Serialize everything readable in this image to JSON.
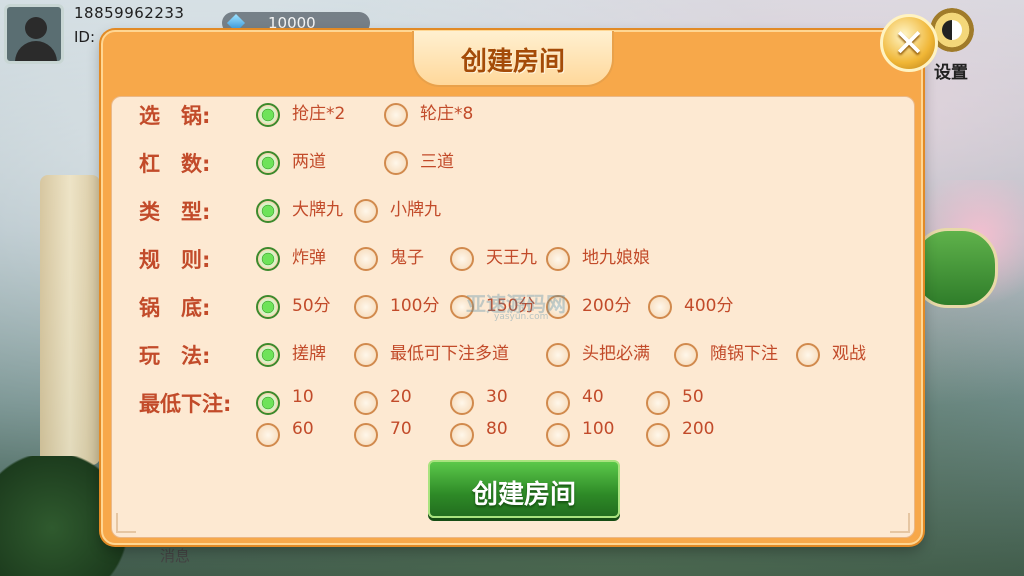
{
  "user": {
    "phone": "18859962233",
    "id_label": "ID:"
  },
  "currency": {
    "icon": "diamond-icon",
    "value": "10000"
  },
  "settings": {
    "label": "设置",
    "icon": "gear-icon"
  },
  "modal": {
    "title": "创建房间",
    "close_icon": "close-icon",
    "rows": [
      {
        "key": "pot",
        "label": "选    锅:",
        "options": [
          "抢庄*2",
          "轮庄*8"
        ],
        "selected": [
          0
        ]
      },
      {
        "key": "bars",
        "label": "杠    数:",
        "options": [
          "两道",
          "三道"
        ],
        "selected": [
          0
        ]
      },
      {
        "key": "type",
        "label": "类    型:",
        "options": [
          "大牌九",
          "小牌九"
        ],
        "selected": [
          0
        ]
      },
      {
        "key": "rules",
        "label": "规    则:",
        "options": [
          "炸弹",
          "鬼子",
          "天王九",
          "地九娘娘"
        ],
        "selected": [
          0
        ]
      },
      {
        "key": "base",
        "label": "锅    底:",
        "options": [
          "50分",
          "100分",
          "150分",
          "200分",
          "400分"
        ],
        "selected": [
          0
        ]
      },
      {
        "key": "play",
        "label": "玩    法:",
        "options": [
          "搓牌",
          "最低可下注多道",
          "头把必满",
          "随锅下注",
          "观战"
        ],
        "selected": [
          0
        ]
      },
      {
        "key": "min_bet",
        "label": "最低下注:",
        "options": [
          "10",
          "20",
          "30",
          "40",
          "50",
          "60",
          "70",
          "80",
          "100",
          "200"
        ],
        "selected": [
          0
        ]
      }
    ],
    "create_button": "创建房间"
  },
  "watermark": {
    "text": "亚速源码网",
    "sub": "yasyun.com"
  },
  "bottom_tag": "消息"
}
